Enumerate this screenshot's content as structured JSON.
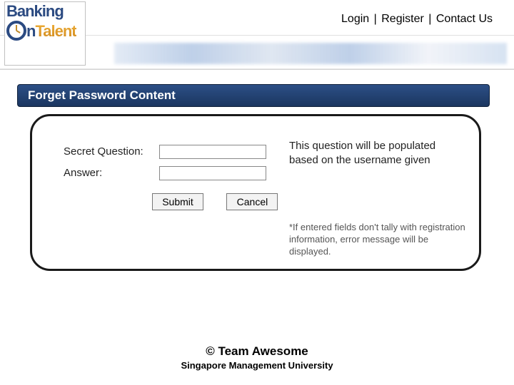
{
  "brand": {
    "word1": "Banking",
    "word2_n": "n",
    "word2_rest": "Talent"
  },
  "header": {
    "login": "Login",
    "register": "Register",
    "contact": "Contact Us",
    "sep": " | "
  },
  "panel": {
    "title": "Forget Password Content",
    "secret_label": "Secret Question:",
    "answer_label": "Answer:",
    "secret_value": "",
    "answer_value": "",
    "note_populate": "This question will be populated based on the username given",
    "note_error": "*If entered fields don't tally with registration information, error message will be displayed.",
    "submit": "Submit",
    "cancel": "Cancel"
  },
  "footer": {
    "line1": "© Team Awesome",
    "line2": "Singapore Management University"
  }
}
